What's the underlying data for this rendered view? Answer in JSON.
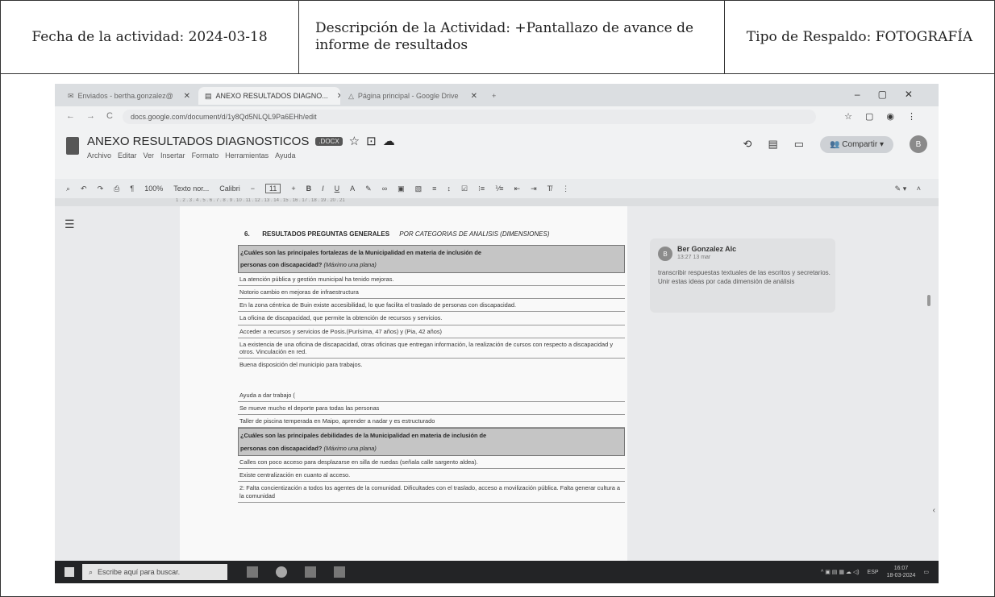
{
  "header": {
    "date_label": "Fecha de la actividad: 2024-03-18",
    "description_label": "Descripción de la Actividad: +Pantallazo de avance de informe de resultados",
    "backup_type_label": "Tipo de Respaldo: FOTOGRAFÍA"
  },
  "browser": {
    "tabs": [
      {
        "label": "Enviados - bertha.gonzalez@"
      },
      {
        "label": "ANEXO RESULTADOS DIAGNO..."
      },
      {
        "label": "Página principal - Google Drive"
      }
    ],
    "new_tab": "+",
    "url": "docs.google.com/document/d/1y8Qd5NLQL9Pa6EHh/edit"
  },
  "docs": {
    "title": "ANEXO RESULTADOS DIAGNOSTICOS",
    "badge": ".DOCX",
    "menus": [
      "Archivo",
      "Editar",
      "Ver",
      "Insertar",
      "Formato",
      "Herramientas",
      "Ayuda"
    ],
    "share_label": "Compartir",
    "avatar_letter": "B",
    "toolbar": {
      "zoom": "100%",
      "style": "Texto nor...",
      "font": "Calibri",
      "size": "11"
    },
    "ruler": "1 . 2 . 3 . 4 . 5 . 6 . 7 . 8 . 9 . 10 . 11 . 12 . 13 . 14 . 15 . 16 . 17 . 18 . 19 . 20 . 21"
  },
  "page": {
    "section_number": "6.",
    "section_title": "RESULTADOS PREGUNTAS GENERALES",
    "section_subtitle": "POR CATEGORIAS DE ANALISIS (DIMENSIONES)",
    "q1_line1": "¿Cuáles son las principales fortalezas de la Municipalidad en materia de inclusión de",
    "q1_line2": "personas con discapacidad?",
    "q1_hint": "(Máximo una plana)",
    "answers1": [
      "La atención pública y gestión municipal ha tenido mejoras.",
      "Notorio cambio en mejoras de infraestructura",
      "En la zona céntrica de Buin existe accesibilidad, lo que facilita el traslado de personas con discapacidad.",
      "La oficina de discapacidad, que permite la obtención de recursos y servicios.",
      "Acceder a recursos y servicios de Posis.(Purísima, 47 años) y (Pia, 42 años)",
      "La existencia de una oficina de discapacidad, otras oficinas que entregan información, la realización de cursos con respecto a discapacidad y otros. Vinculación en red.",
      "Buena disposición del municipio para trabajos."
    ],
    "answers1b": [
      "Ayuda a dar trabajo (",
      "Se mueve mucho el deporte para todas las personas",
      "Taller de piscina temperada en Maipo, aprender a nadar y es estructurado"
    ],
    "q2_line1": "¿Cuáles son las principales debilidades de la Municipalidad en materia de inclusión de",
    "q2_line2": "personas con discapacidad?",
    "q2_hint": "(Máximo una plana)",
    "answers2": [
      "Calles con poco acceso para desplazarse en silla de ruedas (señala calle sargento aldea).",
      "Existe centralización en cuanto al acceso.",
      "2: Falta concientización a todos los agentes de la comunidad. Dificultades con el traslado, acceso a movilización pública. Falta generar cultura a la comunidad"
    ]
  },
  "comment": {
    "avatar_letter": "B",
    "author": "Ber Gonzalez Alc",
    "time": "13:27 13 mar",
    "text": "transcribir respuestas textuales de las escritos y secretarios. Unir estas ideas por cada dimensión de análisis"
  },
  "taskbar": {
    "search_placeholder": "Escribe aquí para buscar.",
    "lang": "ESP",
    "time": "16:07",
    "date": "18-03-2024"
  }
}
